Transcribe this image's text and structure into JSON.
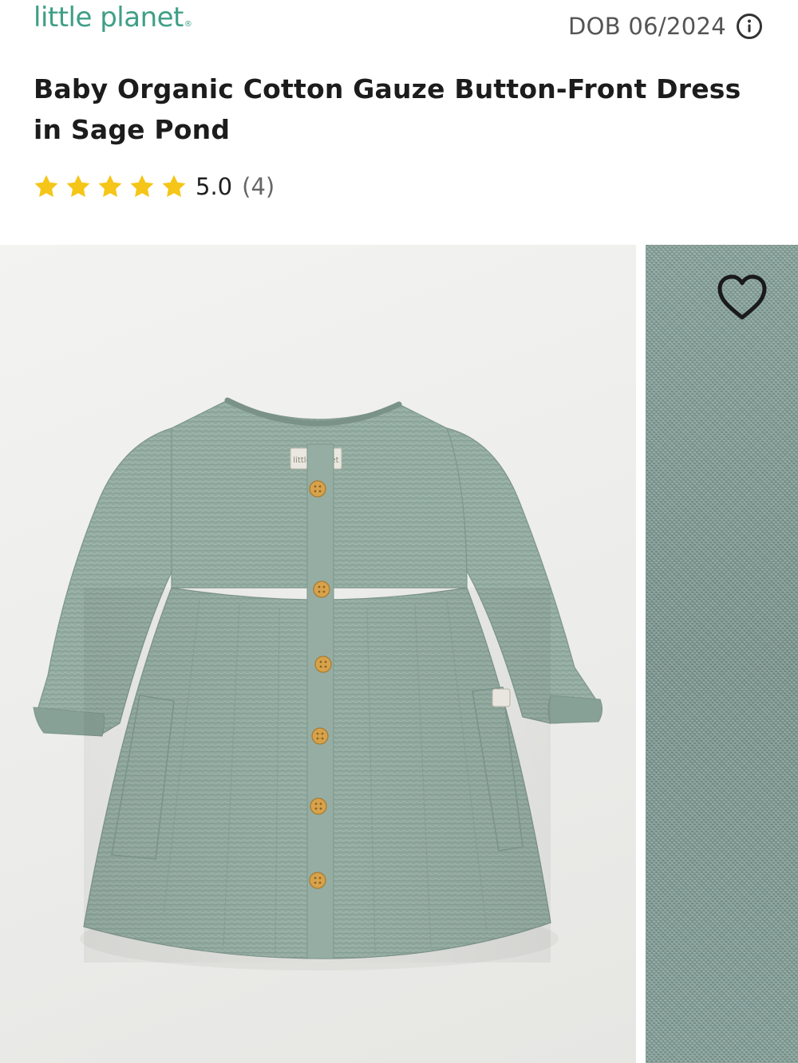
{
  "header": {
    "brand": "little planet",
    "brand_mark": "®",
    "dob": "DOB 06/2024",
    "info_icon": "info-circle-icon"
  },
  "product": {
    "title": "Baby Organic Cotton Gauze Button-Front Dress in Sage Pond",
    "rating": {
      "stars": 5,
      "max_stars": 5,
      "value": "5.0",
      "count": "(4)",
      "star_color": "#F5C518"
    }
  },
  "gallery": {
    "images": [
      {
        "description_icon": "sage-dress-photo"
      },
      {
        "description_icon": "fabric-texture-photo"
      }
    ],
    "wishlist_icon": "heart-outline-icon"
  },
  "colors": {
    "brand_green": "#3F9F86",
    "sage_dress": "#8FA89E"
  }
}
